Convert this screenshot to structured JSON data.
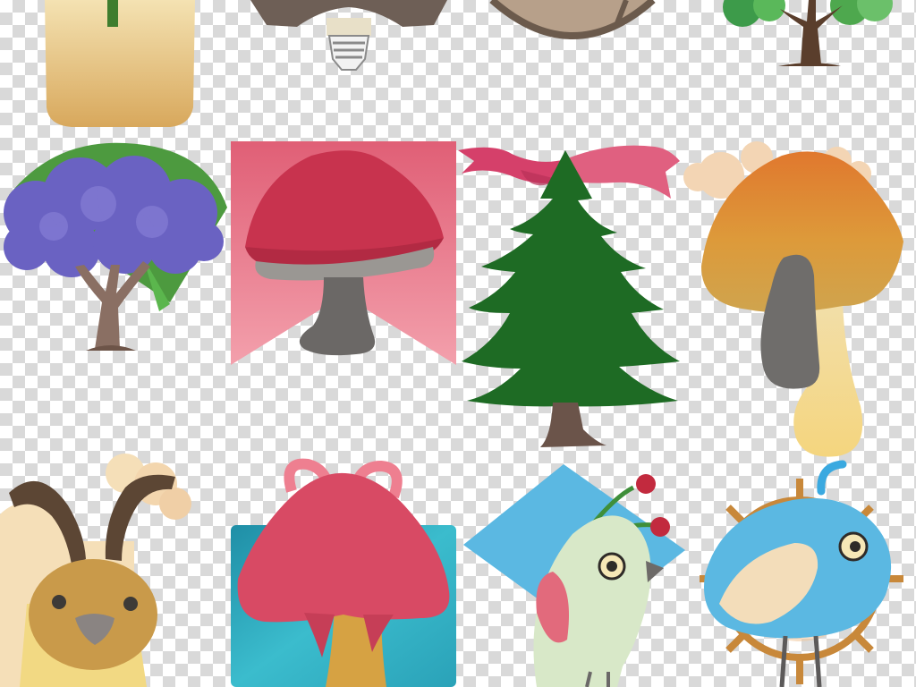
{
  "background": {
    "pattern": "transparency-checkerboard",
    "light": "#ffffff",
    "dark": "#d9d9d9"
  },
  "colors": {
    "pink": "#d84a64",
    "rose": "#ee8494",
    "green": "#1e6b24",
    "purple": "#6a62c2",
    "teal": "#2fa6b8",
    "sky": "#5bb8e2",
    "orange": "#e0782e",
    "ochre": "#d6a243",
    "cream": "#f5dfb8",
    "brown": "#6a4e3c",
    "grey": "#7a7775"
  },
  "illustrations": [
    {
      "icon": "candle-jar-icon",
      "row": 0,
      "col": 0
    },
    {
      "icon": "light-bulb-icon",
      "row": 0,
      "col": 1
    },
    {
      "icon": "ship-wheel-icon",
      "row": 0,
      "col": 2
    },
    {
      "icon": "small-tree-icon",
      "row": 0,
      "col": 3
    },
    {
      "icon": "purple-tree-icon",
      "row": 1,
      "col": 0
    },
    {
      "icon": "red-mushroom-banner-icon",
      "row": 1,
      "col": 1
    },
    {
      "icon": "pine-tree-ribbon-icon",
      "row": 1,
      "col": 2
    },
    {
      "icon": "orange-mushroom-icon",
      "row": 1,
      "col": 3
    },
    {
      "icon": "deer-icon",
      "row": 2,
      "col": 0
    },
    {
      "icon": "mushroom-gift-icon",
      "row": 2,
      "col": 1
    },
    {
      "icon": "green-bird-icon",
      "row": 2,
      "col": 2
    },
    {
      "icon": "blue-bird-wheel-icon",
      "row": 2,
      "col": 3
    }
  ]
}
